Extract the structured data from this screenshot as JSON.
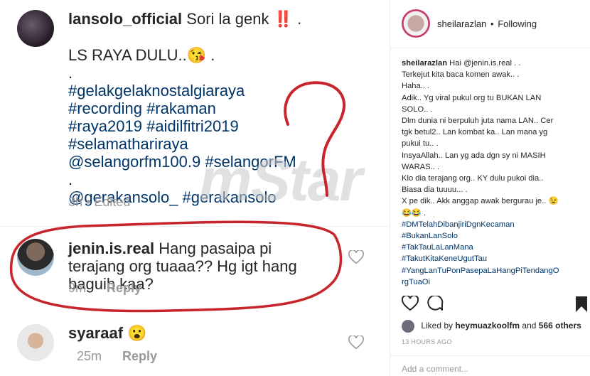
{
  "left_panel": {
    "caption": {
      "username": "lansolo_official",
      "text": "Sori la genk ‼️ .",
      "lines": [
        {
          "text": "LS RAYA DULU..😘 .",
          "tag": false
        },
        {
          "text": ".",
          "tag": false
        },
        {
          "text": "#gelakgelaknostalgiaraya",
          "tag": true
        },
        {
          "text": "#recording #rakaman",
          "tag": true
        },
        {
          "text": "#raya2019 #aidilfitri2019",
          "tag": true
        },
        {
          "text": "#selamathariraya",
          "tag": true
        },
        {
          "text": "@selangorfm100.9 #selangorFM",
          "tag": true
        },
        {
          "text": ".",
          "tag": false
        },
        {
          "text": "@gerakansolo_ #gerakansolo",
          "tag": true
        }
      ],
      "time": "3h",
      "edited": "Edited"
    },
    "comments": [
      {
        "username": "jenin.is.real",
        "text": "Hang pasaipa pi terajang org tuaaa?? Hg igt hang baguih kaa?",
        "time": "9m",
        "reply": "Reply"
      },
      {
        "username": "syaraaf",
        "text": "😮",
        "time": "25m",
        "reply": "Reply"
      }
    ],
    "watermark": "mStar",
    "annotation_color": "#c8242b"
  },
  "post": {
    "header": {
      "username": "sheilarazlan",
      "separator": "•",
      "follow_state": "Following"
    },
    "caption_username": "sheilarazlan",
    "caption_lines": [
      {
        "text": "Hai @jenin.is.real . .",
        "tag": false
      },
      {
        "text": "Terkejut kita baca komen awak.. .",
        "tag": false
      },
      {
        "text": "Haha.. .",
        "tag": false
      },
      {
        "text": "Adik.. Yg viral pukul org tu BUKAN LAN",
        "tag": false
      },
      {
        "text": "SOLO.. .",
        "tag": false
      },
      {
        "text": "Dlm dunia ni berpuluh juta nama LAN.. Cer",
        "tag": false
      },
      {
        "text": "tgk betul2.. Lan kombat ka.. Lan mana yg",
        "tag": false
      },
      {
        "text": "pukui tu.. .",
        "tag": false
      },
      {
        "text": "InsyaAllah.. Lan yg ada dgn sy ni MASIH",
        "tag": false
      },
      {
        "text": "WARAS.. .",
        "tag": false
      },
      {
        "text": "Klo dia terajang org.. KY dulu pukoi dia..",
        "tag": false
      },
      {
        "text": "Biasa dia tuuuu... .",
        "tag": false
      },
      {
        "text": "X pe dik.. Akk anggap awak bergurau je.. 😉",
        "tag": false
      },
      {
        "text": "😂😂 .",
        "tag": false
      },
      {
        "text": "#DMTelahDibanjiriDgnKecaman",
        "tag": true
      },
      {
        "text": "#BukanLanSolo",
        "tag": true
      },
      {
        "text": "#TakTauLaLanMana",
        "tag": true
      },
      {
        "text": "#TakutKitaKeneUgutTau",
        "tag": true
      },
      {
        "text": "#YangLanTuPonPasepaLaHangPiTendangO",
        "tag": true
      },
      {
        "text": "rgTuaOi",
        "tag": true
      }
    ],
    "likes": {
      "prefix": "Liked by",
      "user": "heymuazkoolfm",
      "middle": "and",
      "count": "566 others"
    },
    "time_ago": "13 HOURS AGO",
    "add_comment_placeholder": "Add a comment..."
  }
}
